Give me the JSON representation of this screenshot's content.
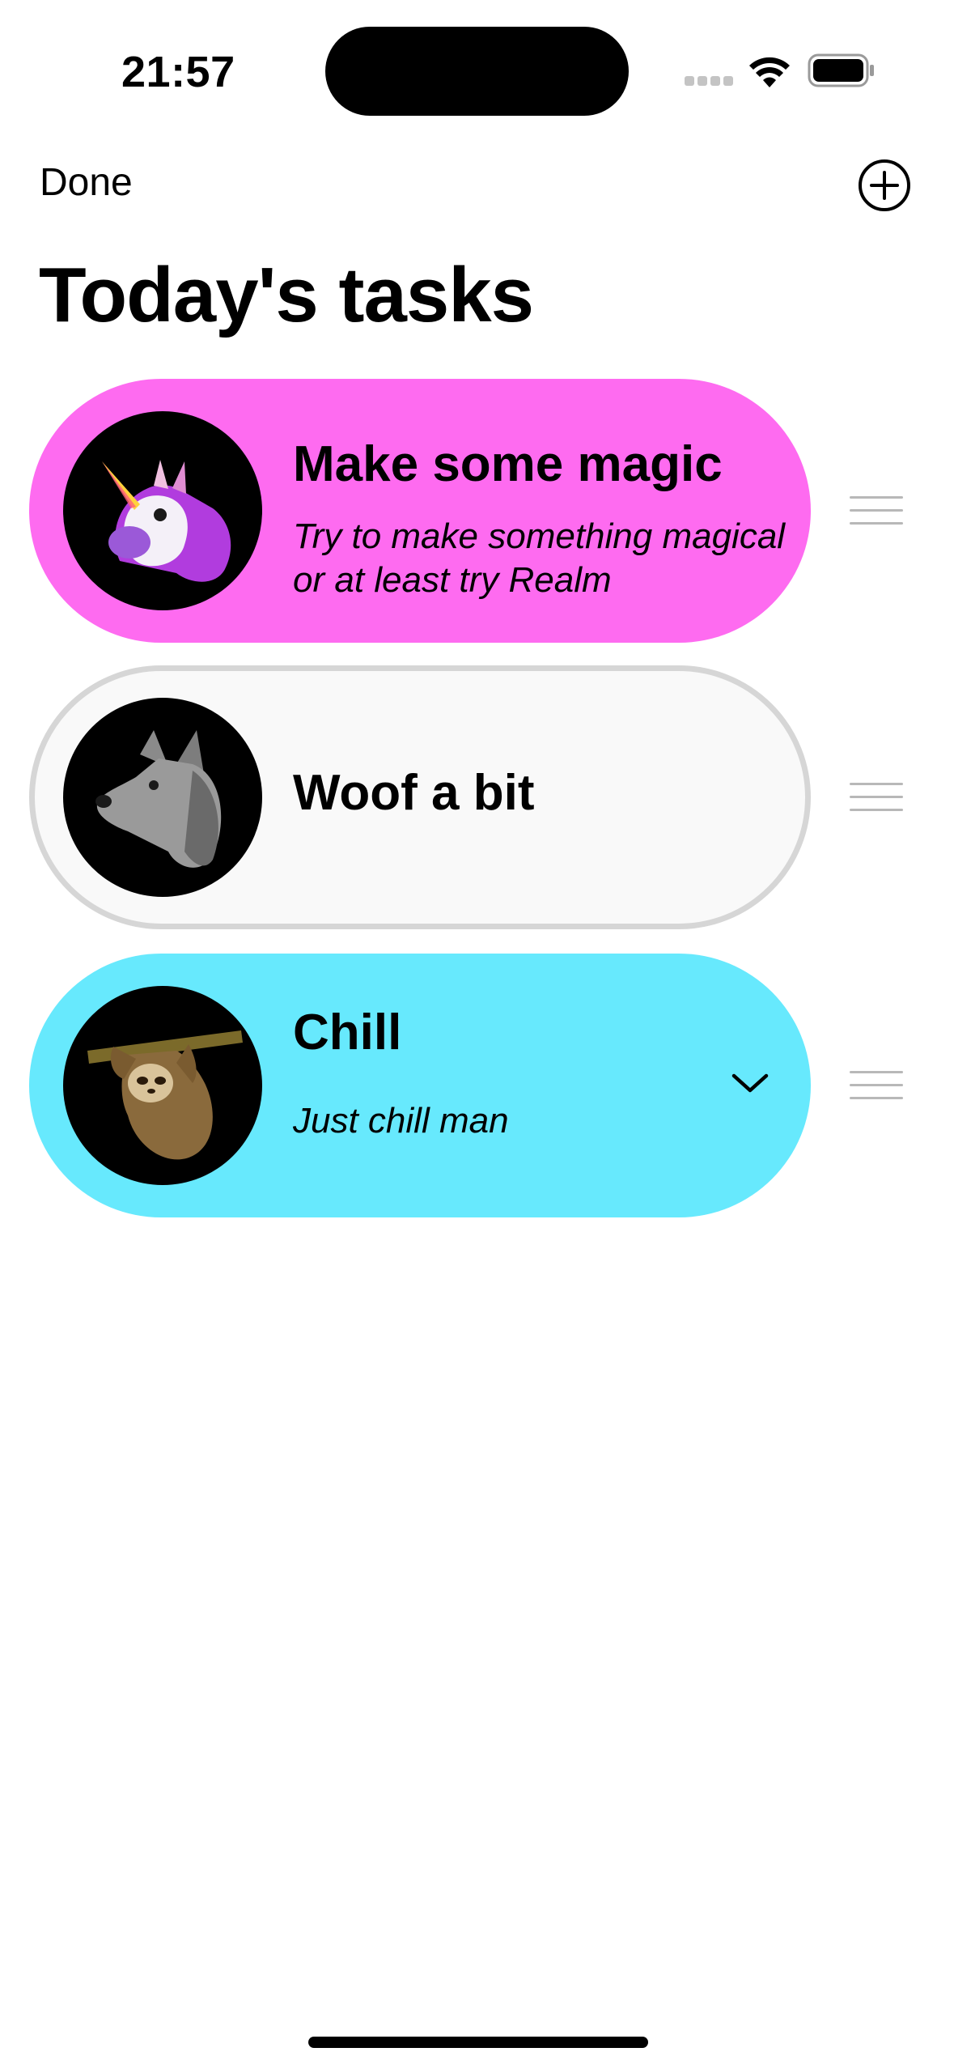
{
  "status_bar": {
    "time": "21:57"
  },
  "nav": {
    "done_label": "Done",
    "add_icon": "plus-circle-icon"
  },
  "page": {
    "title": "Today's tasks"
  },
  "tasks": [
    {
      "title": "Make some magic",
      "description": "Try to make something magical or at least try Realm",
      "color": "#fe6bf0",
      "avatar": "unicorn-emoji",
      "expanded": false
    },
    {
      "title": "Woof a bit",
      "description": "",
      "color": "#f9f9f9",
      "border_color": "#d6d6d6",
      "avatar": "wolf-emoji",
      "expanded": false
    },
    {
      "title": "Chill",
      "description": "Just chill man",
      "color": "#67e9fd",
      "avatar": "sloth-emoji",
      "expanded": true,
      "chevron": "chevron-down-icon"
    }
  ]
}
